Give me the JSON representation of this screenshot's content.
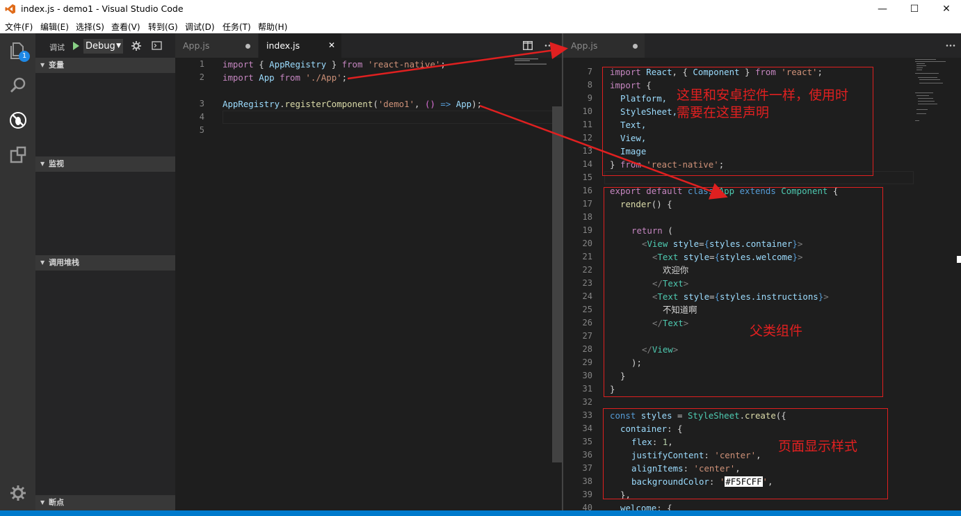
{
  "window": {
    "title": "index.js - demo1 - Visual Studio Code"
  },
  "menu": [
    "文件(F)",
    "编辑(E)",
    "选择(S)",
    "查看(V)",
    "转到(G)",
    "调试(D)",
    "任务(T)",
    "帮助(H)"
  ],
  "activity": {
    "badge": "1"
  },
  "debug": {
    "label": "调试",
    "config": "Debug",
    "sections": [
      "变量",
      "监视",
      "调用堆栈",
      "断点"
    ]
  },
  "editor1": {
    "tabs": [
      {
        "name": "App.js",
        "dirty": true,
        "active": false
      },
      {
        "name": "index.js",
        "dirty": false,
        "active": true
      }
    ],
    "line_numbers": [
      "1",
      "2",
      "3",
      "4",
      "5"
    ]
  },
  "editor2": {
    "tabs": [
      {
        "name": "App.js",
        "dirty": true,
        "active": true
      }
    ],
    "line_numbers": [
      "7",
      "8",
      "9",
      "10",
      "11",
      "12",
      "13",
      "14",
      "15",
      "16",
      "17",
      "18",
      "19",
      "20",
      "21",
      "22",
      "23",
      "24",
      "25",
      "26",
      "27",
      "28",
      "29",
      "30",
      "31",
      "32",
      "33",
      "34",
      "35",
      "36",
      "37",
      "38",
      "39",
      "40"
    ]
  },
  "code1": {
    "l1": {
      "import": "import",
      "ob": "{",
      "name": "AppRegistry",
      "cb": "}",
      "from": "from",
      "str": "'react-native'",
      "semi": ";"
    },
    "l2": {
      "import": "import",
      "name": "App",
      "from": "from",
      "str": "'./App'",
      "semi": ";"
    },
    "l4": {
      "obj": "AppRegistry",
      "dot": ".",
      "fn": "registerComponent",
      "op": "(",
      "str": "'demo1'",
      "comma": ",",
      "arrow_open": "()",
      "arrow": "=>",
      "ret": "App",
      "close": ");"
    }
  },
  "code2": {
    "l7": {
      "import": "import",
      "name": "React",
      "comma": ",",
      "ob": "{",
      "comp": "Component",
      "cb": "}",
      "from": "from",
      "str": "'react'",
      "semi": ";"
    },
    "l8": {
      "import": "import",
      "ob": "{"
    },
    "l9": "Platform,",
    "l10": "StyleSheet,",
    "l11": "Text,",
    "l12": "View,",
    "l13": "Image",
    "l14": {
      "cb": "}",
      "from": "from",
      "str": "'react-native'",
      "semi": ";"
    },
    "l16": {
      "export": "export",
      "default": "default",
      "class": "class",
      "name": "App",
      "extends": "extends",
      "comp": "Component",
      "ob": "{"
    },
    "l17": {
      "fn": "render",
      "rest": "() {"
    },
    "l19": {
      "ret": "return",
      "paren": "("
    },
    "l20": {
      "lt": "<",
      "tag": "View",
      "attr": "style",
      "eq": "=",
      "ob": "{",
      "expr": "styles.container",
      "cb": "}",
      "gt": ">"
    },
    "l21": {
      "lt": "<",
      "tag": "Text",
      "attr": "style",
      "eq": "=",
      "ob": "{",
      "expr": "styles.welcome",
      "cb": "}",
      "gt": ">"
    },
    "l22": "欢迎你",
    "l23": {
      "lt": "</",
      "tag": "Text",
      "gt": ">"
    },
    "l24": {
      "lt": "<",
      "tag": "Text",
      "attr": "style",
      "eq": "=",
      "ob": "{",
      "expr": "styles.instructions",
      "cb": "}",
      "gt": ">"
    },
    "l25": "不知道啊",
    "l26": {
      "lt": "</",
      "tag": "Text",
      "gt": ">"
    },
    "l28": {
      "lt": "</",
      "tag": "View",
      "gt": ">"
    },
    "l29": ");",
    "l30": "}",
    "l31": "}",
    "l33": {
      "const": "const",
      "name": "styles",
      "eq": "=",
      "obj": "StyleSheet",
      "dot": ".",
      "fn": "create",
      "open": "({"
    },
    "l34": {
      "key": "container",
      "rest": ": {"
    },
    "l35": {
      "key": "flex",
      "colon": ":",
      "num": "1",
      "comma": ","
    },
    "l36": {
      "key": "justifyContent",
      "colon": ":",
      "str": "'center'",
      "comma": ","
    },
    "l37": {
      "key": "alignItems",
      "colon": ":",
      "str": "'center'",
      "comma": ","
    },
    "l38": {
      "key": "backgroundColor",
      "colon": ":",
      "q1": "'",
      "color": "#F5FCFF",
      "q2": "'",
      "comma": ","
    },
    "l39": "},",
    "l40": {
      "key": "welcome",
      "rest": ": {"
    }
  },
  "annotations": {
    "imports_note_1": "这里和安卓控件一样，使用时",
    "imports_note_2": "需要在这里声明",
    "component_note": "父类组件",
    "styles_note": "页面显示样式"
  },
  "colors": {
    "annotation": "#e02020",
    "statusbar": "#007acc",
    "activitybar": "#333333",
    "sidebar": "#252526",
    "editor": "#1e1e1e"
  }
}
